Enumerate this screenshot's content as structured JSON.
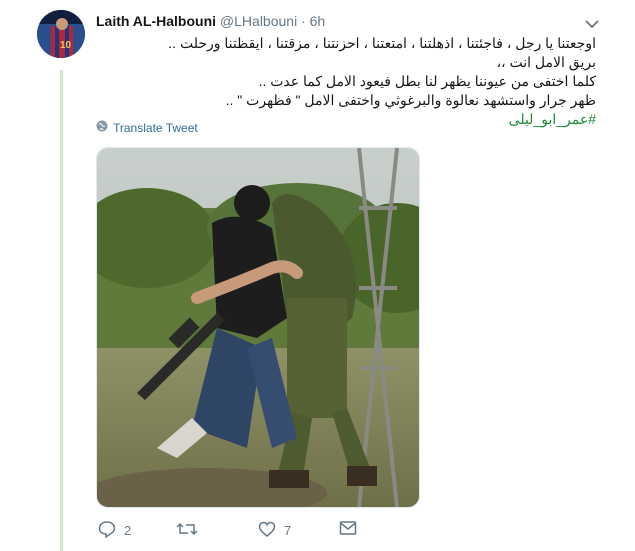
{
  "tweet": {
    "author_name": "Laith AL-Halbouni",
    "author_handle": "@LHalbouni",
    "separator": "·",
    "time": "6h",
    "lines": [
      "اوجعتنا يا رجل ، فاجئتنا ، اذهلتنا ، امتعتنا ، احزنتنا ، مزقتنا ، ايقظتنا ورحلت ..",
      "بريق الامل انت ،،",
      "كلما اختفى من عيوننا يظهر لنا بطل فيعود الامل كما عدت ..",
      "ظهر جرار واستشهد نعالوة والبرغوثي واختفى الامل \" فظهرت \" .."
    ],
    "hashtag": "#عمر_ابو_ليلى",
    "translate_label": "Translate Tweet",
    "reply_count": "2",
    "retweet_count": "",
    "like_count": "7"
  },
  "icons": {
    "caret": "chevron-down-icon",
    "translate": "globe-icon",
    "reply": "reply-icon",
    "retweet": "retweet-icon",
    "like": "heart-icon",
    "message": "direct-message-icon"
  },
  "colors": {
    "hashtag": "#1e8a3c",
    "thread_line": "#cfe9cf",
    "link": "#2f6e99",
    "muted": "#657786"
  }
}
